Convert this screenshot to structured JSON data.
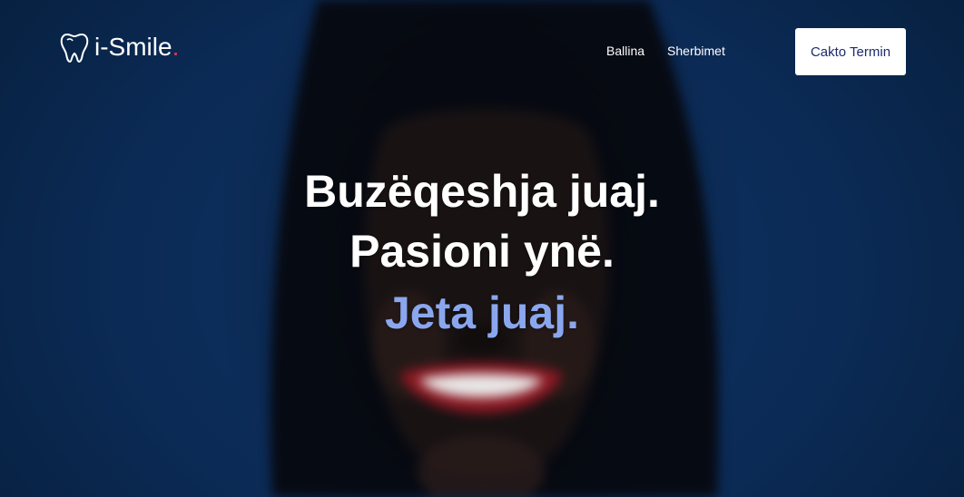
{
  "brand": {
    "name": "i-Smile",
    "dot": ".",
    "logo_icon": "tooth-icon",
    "dot_color": "#e0384a"
  },
  "nav": {
    "items": [
      {
        "label": "Ballina"
      },
      {
        "label": "Sherbimet"
      }
    ],
    "cta_label": "Cakto Termin"
  },
  "hero": {
    "line1": "Buzëqeshja juaj.",
    "line2": "Pasioni ynë.",
    "line3": "Jeta juaj.",
    "accent_color": "#8aa7ee",
    "background_color": "#0b2a55"
  }
}
